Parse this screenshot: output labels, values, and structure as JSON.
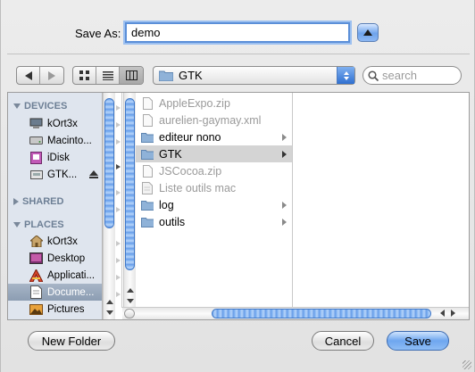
{
  "dialog": {
    "save_as_label": "Save As:",
    "filename_value": "demo"
  },
  "toolbar": {
    "current_folder": "GTK",
    "search_placeholder": "search"
  },
  "sidebar": {
    "sections": [
      {
        "header": "DEVICES",
        "expanded": true,
        "items": [
          {
            "label": "kOrt3x",
            "icon": "computer-icon"
          },
          {
            "label": "Macinto...",
            "icon": "hard-drive-icon"
          },
          {
            "label": "iDisk",
            "icon": "idisk-icon"
          },
          {
            "label": "GTK...",
            "icon": "disk-image-icon",
            "ejectable": true
          }
        ]
      },
      {
        "header": "SHARED",
        "expanded": false,
        "items": []
      },
      {
        "header": "PLACES",
        "expanded": true,
        "items": [
          {
            "label": "kOrt3x",
            "icon": "home-icon"
          },
          {
            "label": "Desktop",
            "icon": "desktop-icon"
          },
          {
            "label": "Applicati...",
            "icon": "applications-icon"
          },
          {
            "label": "Docume...",
            "icon": "documents-icon",
            "selected": true
          },
          {
            "label": "Pictures",
            "icon": "pictures-icon"
          }
        ]
      }
    ]
  },
  "files": [
    {
      "name": "AppleExpo.zip",
      "type": "file",
      "enabled": false
    },
    {
      "name": "aurelien-gaymay.xml",
      "type": "file",
      "enabled": false
    },
    {
      "name": "editeur nono",
      "type": "folder",
      "enabled": true
    },
    {
      "name": "GTK",
      "type": "folder",
      "enabled": true,
      "selected": true
    },
    {
      "name": "JSCocoa.zip",
      "type": "file",
      "enabled": false
    },
    {
      "name": "Liste outils mac",
      "type": "file",
      "enabled": false
    },
    {
      "name": "log",
      "type": "folder",
      "enabled": true
    },
    {
      "name": "outils",
      "type": "folder",
      "enabled": true
    }
  ],
  "buttons": {
    "new_folder": "New Folder",
    "cancel": "Cancel",
    "save": "Save"
  },
  "colors": {
    "accent": "#5b8fd8",
    "sidebar_bg": "#dfe5ee",
    "sidebar_header": "#6d7f95",
    "selection_gray": "#d4d4d4"
  }
}
